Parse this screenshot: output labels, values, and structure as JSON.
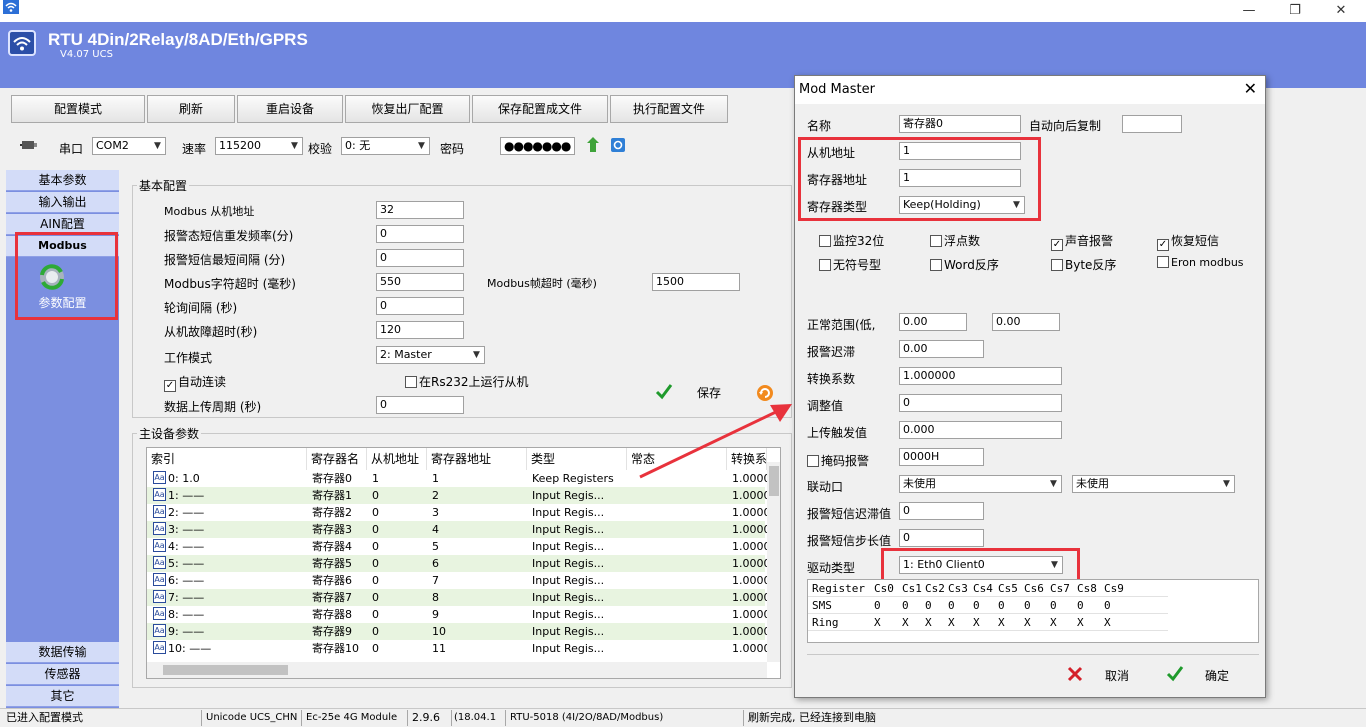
{
  "window": {
    "title": "RTU 4Din/2Relay/8AD/Eth/GPRS",
    "version": "V4.07 UCS",
    "minimize_glyph": "—",
    "restore_glyph": "❐",
    "close_glyph": "✕",
    "logo_icon": "wifi-icon"
  },
  "toolbar": {
    "buttons": [
      "配置模式",
      "刷新",
      "重启设备",
      "恢复出厂配置",
      "保存配置成文件",
      "执行配置文件"
    ]
  },
  "connbar": {
    "port_label": "串口",
    "port_value": "COM2",
    "baud_label": "速率",
    "baud_value": "115200",
    "parity_label": "校验",
    "parity_value": "0: 无",
    "password_label": "密码",
    "password_value": "●●●●●●●"
  },
  "nav": {
    "items_top": [
      "基本参数",
      "输入输出",
      "AIN配置",
      "Modbus"
    ],
    "active_icon_label": "参数配置",
    "items_bottom": [
      "数据传输",
      "传感器",
      "其它"
    ]
  },
  "basic": {
    "group_title": "基本配置",
    "slave_addr_label": "Modbus 从机地址",
    "slave_addr_value": "32",
    "alarm_resend_label": "报警态短信重发频率(分)",
    "alarm_resend_value": "0",
    "alarm_min_interval_label": "报警短信最短间隔 (分)",
    "alarm_min_interval_value": "0",
    "char_timeout_label": "Modbus字符超时 (毫秒)",
    "char_timeout_value": "550",
    "frame_timeout_label": "Modbus帧超时 (毫秒)",
    "frame_timeout_value": "1500",
    "poll_interval_label": "轮询间隔 (秒)",
    "poll_interval_value": "0",
    "slave_fault_label": "从机故障超时(秒)",
    "slave_fault_value": "120",
    "work_mode_label": "工作模式",
    "work_mode_value": "2: Master",
    "auto_connect_label": "自动连读",
    "auto_connect_checked": true,
    "rs232_slave_label": "在Rs232上运行从机",
    "rs232_slave_checked": false,
    "upload_period_label": "数据上传周期 (秒)",
    "upload_period_value": "0",
    "save_label": "保存"
  },
  "master_table": {
    "group_title": "主设备参数",
    "headers": [
      "索引",
      "寄存器名",
      "从机地址",
      "寄存器地址",
      "类型",
      "常态",
      "转换系"
    ],
    "rows": [
      [
        "0: 1.0",
        "寄存器0",
        "1",
        "1",
        "Keep Registers",
        "",
        "1.0000"
      ],
      [
        "1: ——",
        "寄存器1",
        "0",
        "2",
        "Input Regis...",
        "",
        "1.0000"
      ],
      [
        "2: ——",
        "寄存器2",
        "0",
        "3",
        "Input Regis...",
        "",
        "1.0000"
      ],
      [
        "3: ——",
        "寄存器3",
        "0",
        "4",
        "Input Regis...",
        "",
        "1.0000"
      ],
      [
        "4: ——",
        "寄存器4",
        "0",
        "5",
        "Input Regis...",
        "",
        "1.0000"
      ],
      [
        "5: ——",
        "寄存器5",
        "0",
        "6",
        "Input Regis...",
        "",
        "1.0000"
      ],
      [
        "6: ——",
        "寄存器6",
        "0",
        "7",
        "Input Regis...",
        "",
        "1.0000"
      ],
      [
        "7: ——",
        "寄存器7",
        "0",
        "8",
        "Input Regis...",
        "",
        "1.0000"
      ],
      [
        "8: ——",
        "寄存器8",
        "0",
        "9",
        "Input Regis...",
        "",
        "1.0000"
      ],
      [
        "9: ——",
        "寄存器9",
        "0",
        "10",
        "Input Regis...",
        "",
        "1.0000"
      ],
      [
        "10: ——",
        "寄存器10",
        "0",
        "11",
        "Input Regis...",
        "",
        "1.0000"
      ]
    ]
  },
  "status": {
    "mode": "已进入配置模式",
    "encoding": "Unicode UCS_CHN",
    "module": "Ec-25e 4G Module",
    "fw": "2.9.6",
    "date": "(18.04.1",
    "model": "RTU-5018 (4I/2O/8AD/Modbus)",
    "message": "刷新完成, 已经连接到电脑"
  },
  "dialog": {
    "title": "Mod Master",
    "name_label": "名称",
    "name_value": "寄存器0",
    "auto_copy_label": "自动向后复制",
    "auto_copy_value": "",
    "slave_addr_label": "从机地址",
    "slave_addr_value": "1",
    "reg_addr_label": "寄存器地址",
    "reg_addr_value": "1",
    "reg_type_label": "寄存器类型",
    "reg_type_value": "Keep(Holding)",
    "cb_monitor32_label": "监控32位",
    "cb_monitor32_checked": false,
    "cb_float_label": "浮点数",
    "cb_float_checked": false,
    "cb_sound_label": "声音报警",
    "cb_sound_checked": true,
    "cb_restore_sms_label": "恢复短信",
    "cb_restore_sms_checked": true,
    "cb_unsigned_label": "无符号型",
    "cb_unsigned_checked": false,
    "cb_word_rev_label": "Word反序",
    "cb_word_rev_checked": false,
    "cb_byte_rev_label": "Byte反序",
    "cb_byte_rev_checked": false,
    "cb_eron_label": "Eron modbus",
    "cb_eron_checked": false,
    "normal_range_label": "正常范围(低,",
    "normal_low": "0.00",
    "normal_high": "0.00",
    "alarm_delay_label": "报警迟滞",
    "alarm_delay_value": "0.00",
    "conv_coef_label": "转换系数",
    "conv_coef_value": "1.000000",
    "adjust_label": "调整值",
    "adjust_value": "0",
    "upload_trigger_label": "上传触发值",
    "upload_trigger_value": "0.000",
    "mask_alarm_label": "掩码报警",
    "mask_alarm_checked": false,
    "mask_alarm_value": "0000H",
    "link_port_label": "联动口",
    "link_port_value1": "未使用",
    "link_port_value2": "未使用",
    "sms_delay_label": "报警短信迟滞值",
    "sms_delay_value": "0",
    "sms_step_label": "报警短信步长值",
    "sms_step_value": "0",
    "driver_label": "驱动类型",
    "driver_value": "1: Eth0 Client0",
    "grid_headers": [
      "Register",
      "Cs0",
      "Cs1",
      "Cs2",
      "Cs3",
      "Cs4",
      "Cs5",
      "Cs6",
      "Cs7",
      "Cs8",
      "Cs9"
    ],
    "grid_rows": [
      [
        "SMS",
        "0",
        "0",
        "0",
        "0",
        "0",
        "0",
        "0",
        "0",
        "0",
        "0"
      ],
      [
        "Ring",
        "X",
        "X",
        "X",
        "X",
        "X",
        "X",
        "X",
        "X",
        "X",
        "X"
      ]
    ],
    "cancel_label": "取消",
    "ok_label": "确定"
  },
  "colors": {
    "titlebar": "#6f86df",
    "nav_bg": "#7b8fe0",
    "highlight": "#e8323c",
    "row_alt": "#e8f4e0"
  }
}
